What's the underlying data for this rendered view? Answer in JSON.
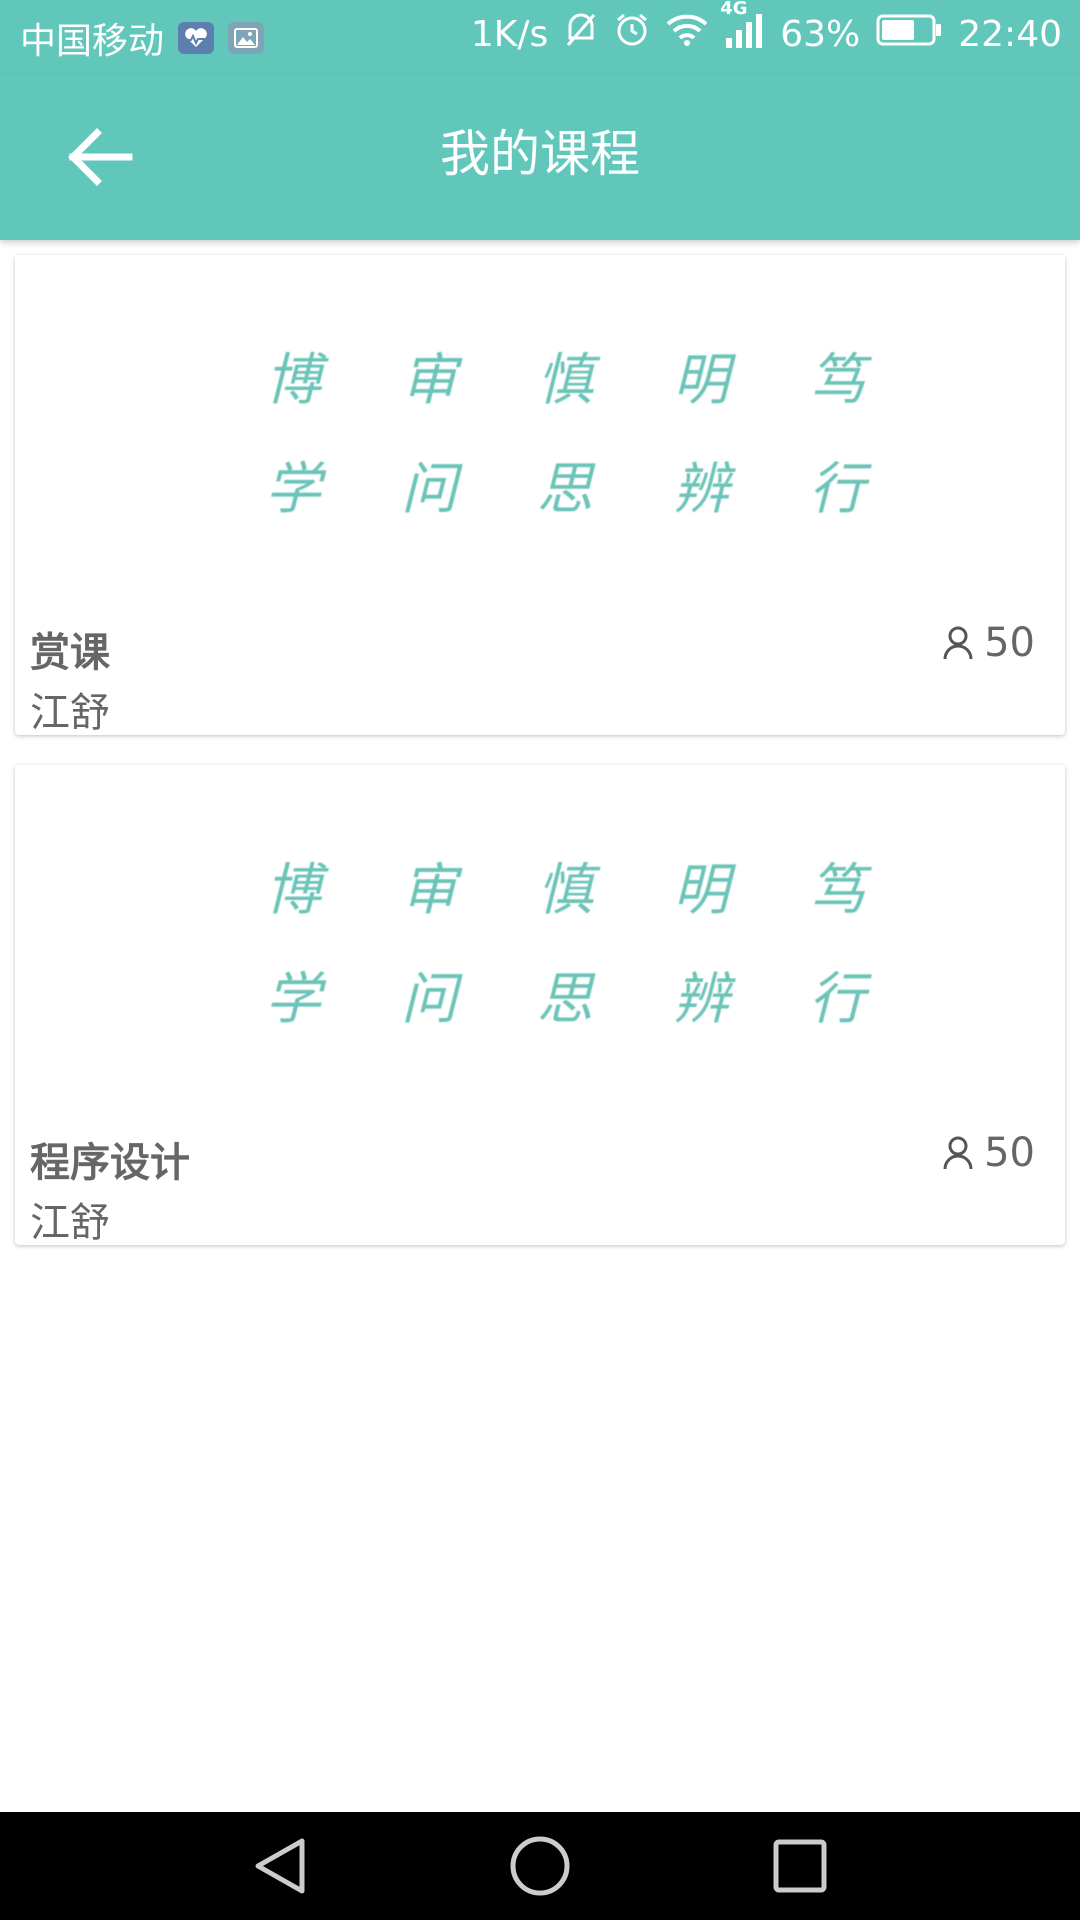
{
  "status_bar": {
    "carrier": "中国移动",
    "net_speed": "1K/s",
    "network_type": "4G",
    "battery": "63%",
    "time": "22:40"
  },
  "toolbar": {
    "title": "我的课程",
    "back_icon": "arrow-left-icon"
  },
  "courses": [
    {
      "banner_motto": [
        "博",
        "审",
        "慎",
        "明",
        "笃",
        "学",
        "问",
        "思",
        "辨",
        "行"
      ],
      "title": "赏课",
      "teacher": "江舒",
      "member_count": "50",
      "member_icon": "person-icon"
    },
    {
      "banner_motto": [
        "博",
        "审",
        "慎",
        "明",
        "笃",
        "学",
        "问",
        "思",
        "辨",
        "行"
      ],
      "title": "程序设计",
      "teacher": "江舒",
      "member_count": "50",
      "member_icon": "person-icon"
    }
  ],
  "nav_bar": {
    "back_icon": "nav-back-icon",
    "home_icon": "nav-home-icon",
    "recents_icon": "nav-recents-icon"
  },
  "colors": {
    "accent": "#62c7bb",
    "motto": "#6cc4b8",
    "text_secondary": "#666666"
  }
}
